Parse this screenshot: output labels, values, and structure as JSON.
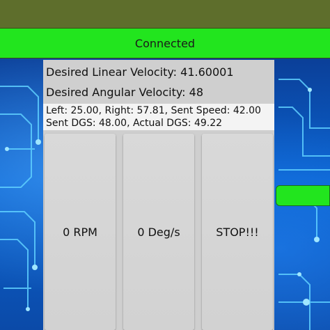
{
  "status": {
    "connection": "Connected"
  },
  "readouts": {
    "linear_velocity": "Desired Linear Velocity: 41.60001",
    "angular_velocity": "Desired Angular Velocity: 48",
    "motor_line": "Left: 25.00, Right: 57.81, Sent Speed: 42.00",
    "dgs_line": "Sent DGS: 48.00, Actual DGS: 49.22"
  },
  "buttons": {
    "rpm": "0 RPM",
    "deg": "0 Deg/s",
    "stop": "STOP!!!"
  },
  "colors": {
    "status_green": "#22e51e",
    "top_olive": "#5e6e2c",
    "panel_gray": "#cfcfcf",
    "background_blue": "#0a55b8"
  }
}
